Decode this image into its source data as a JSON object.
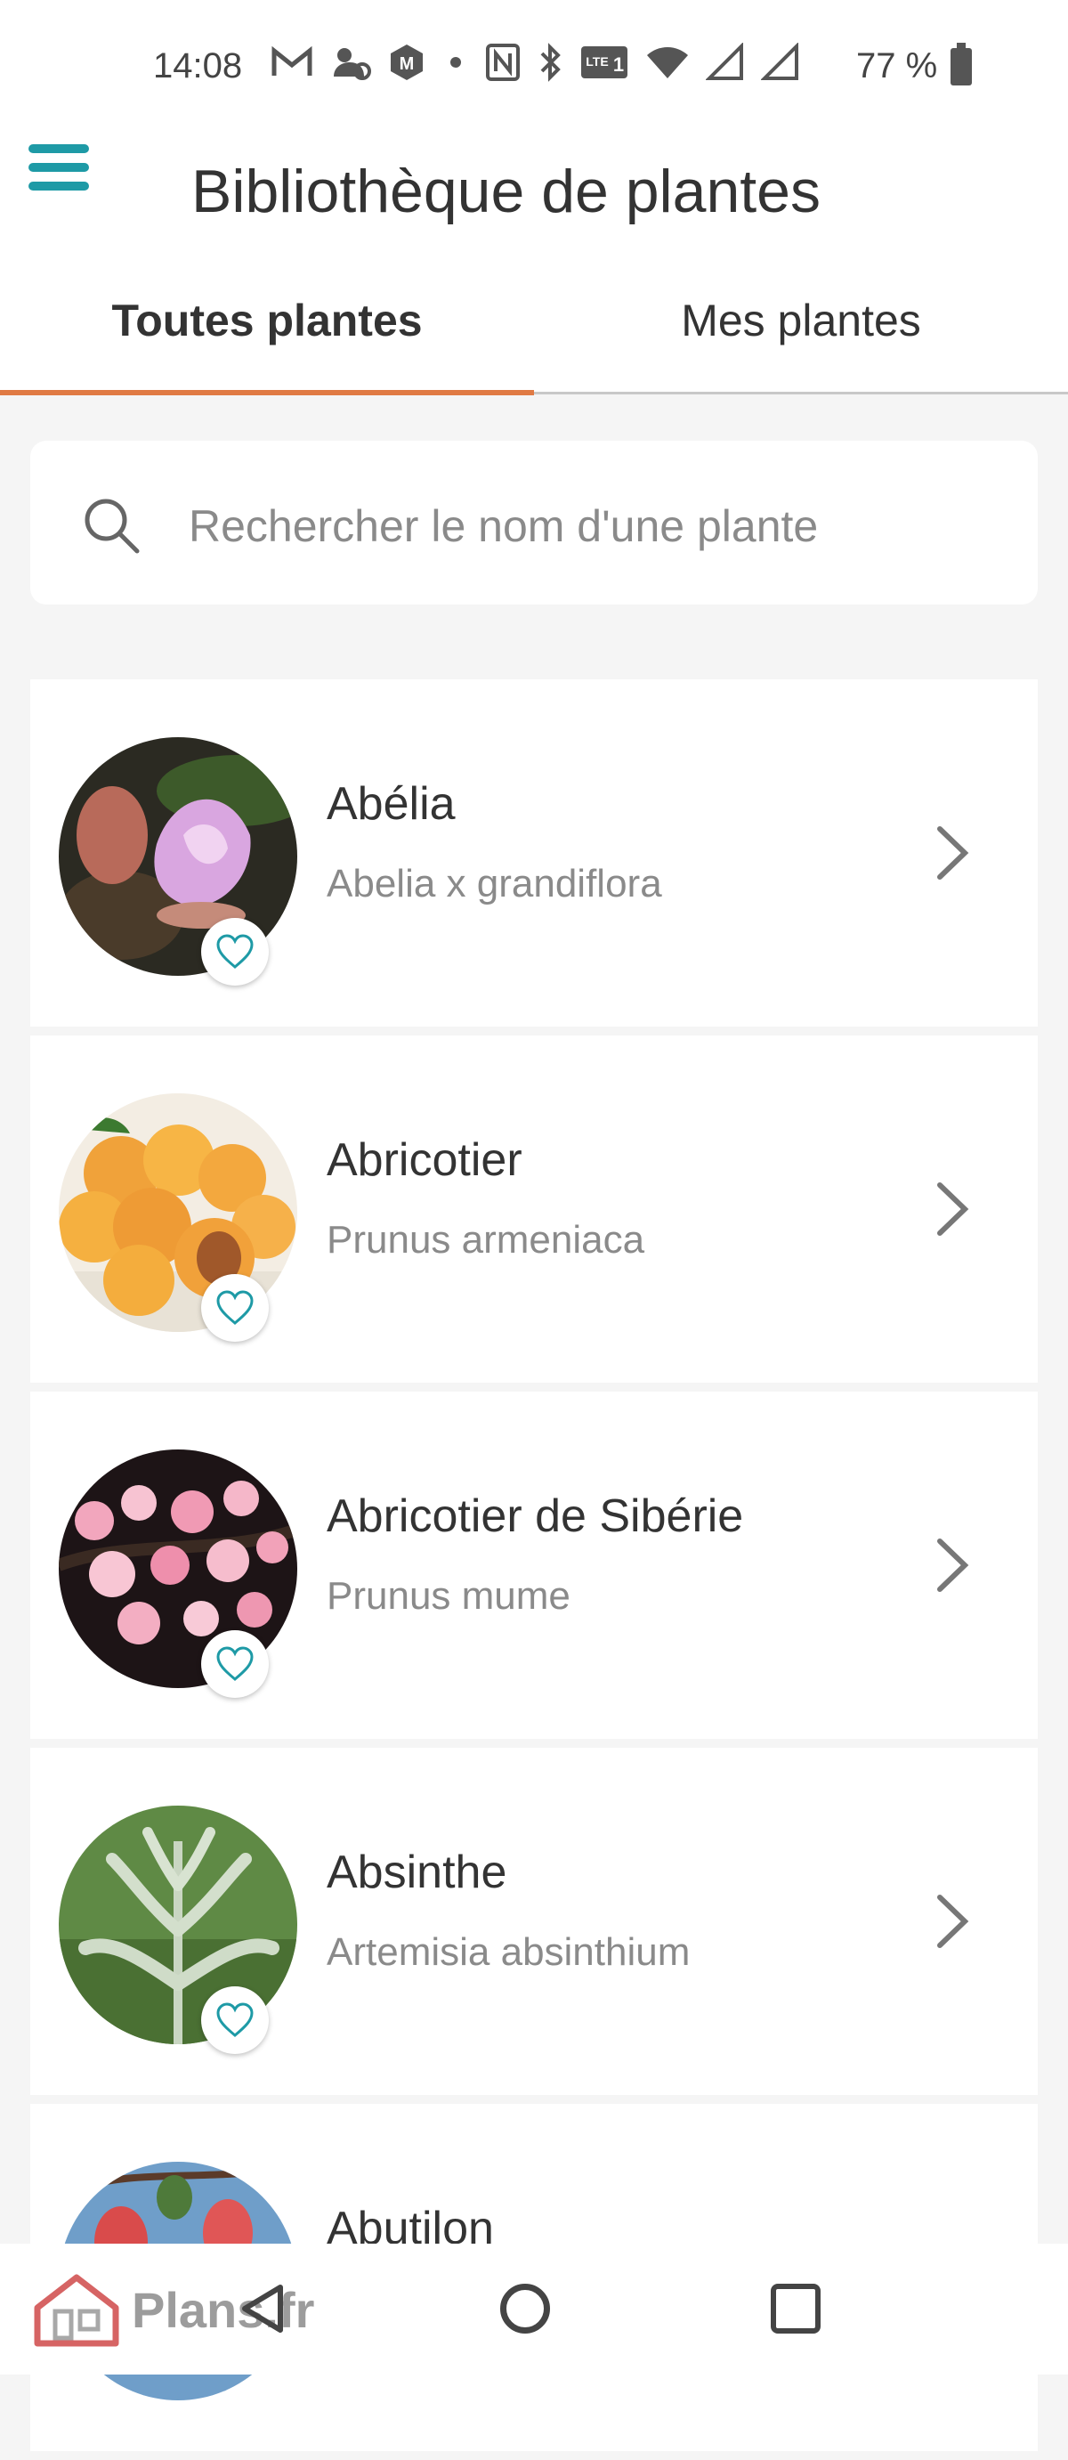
{
  "status_bar": {
    "time": "14:08",
    "icons": [
      "gmail-icon",
      "weather-icon",
      "app-icon",
      "dot-icon",
      "nfc-icon",
      "bluetooth-icon",
      "volte-icon",
      "wifi-icon",
      "signal-icon",
      "signal-icon"
    ],
    "battery": "77 %"
  },
  "app_bar": {
    "menu_icon": "hamburger-menu-icon",
    "title": "Bibliothèque de plantes"
  },
  "tabs": [
    {
      "label": "Toutes plantes",
      "active": true
    },
    {
      "label": "Mes plantes",
      "active": false
    }
  ],
  "search": {
    "placeholder": "Rechercher le nom d'une plante",
    "value": ""
  },
  "plants": [
    {
      "name": "Abélia",
      "latin": "Abelia x grandiflora",
      "favorite": false
    },
    {
      "name": "Abricotier",
      "latin": "Prunus armeniaca",
      "favorite": false
    },
    {
      "name": "Abricotier de Sibérie",
      "latin": "Prunus mume",
      "favorite": false
    },
    {
      "name": "Absinthe",
      "latin": "Artemisia absinthium",
      "favorite": false
    },
    {
      "name": "Abutilon",
      "latin": "",
      "favorite": false
    }
  ],
  "colors": {
    "accent": "#1e9aa6",
    "tab_indicator": "#e07a44",
    "background": "#f5f5f5"
  },
  "watermark": "Plans.fr"
}
